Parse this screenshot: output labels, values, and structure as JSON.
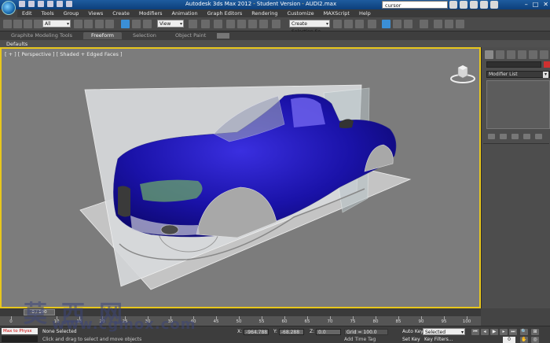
{
  "window": {
    "app_title": "Autodesk 3ds Max 2012",
    "edition": "Student Version",
    "file": "AUDI2.max",
    "search": "cursor"
  },
  "menu": [
    "Edit",
    "Tools",
    "Group",
    "Views",
    "Create",
    "Modifiers",
    "Animation",
    "Graph Editors",
    "Rendering",
    "Customize",
    "MAXScript",
    "Help"
  ],
  "toolbar": {
    "selection_filter": "All",
    "ref_coord": "View",
    "named_selection": "Create Selection Se"
  },
  "ribbon": {
    "tabs": [
      "Graphite Modeling Tools",
      "Freeform",
      "Selection",
      "Object Paint"
    ],
    "active_tab": "Freeform",
    "sub_label": "Defaults"
  },
  "viewport": {
    "label": "[ + ] [ Perspective ] [ Shaded + Edged Faces ]",
    "active_border": "#e8c71c",
    "car_color": "#1a12a8"
  },
  "command_panel": {
    "modifier_list": "Modifier List"
  },
  "timeline": {
    "slider": "0 / 100",
    "ticks": [
      0,
      10,
      15,
      20,
      25,
      30,
      35,
      40,
      45,
      50,
      55,
      60,
      65,
      70,
      75,
      80,
      85,
      90,
      95,
      100
    ]
  },
  "status": {
    "listener": "Max to Physx",
    "selection": "None Selected",
    "prompt": "Click and drag to select and move objects",
    "x_label": "X:",
    "x": "-964.788",
    "y_label": "Y:",
    "y": "-68.288",
    "z_label": "Z:",
    "z": "0.0",
    "grid": "Grid = 100.0",
    "add_time_tag": "Add Time Tag",
    "auto_key": "Auto Key",
    "set_key": "Set Key",
    "key_mode": "Selected",
    "key_filters": "Key Filters...",
    "frame": "0"
  },
  "watermark": {
    "chinese": "莫西网",
    "url": "www.cgmox.com"
  }
}
